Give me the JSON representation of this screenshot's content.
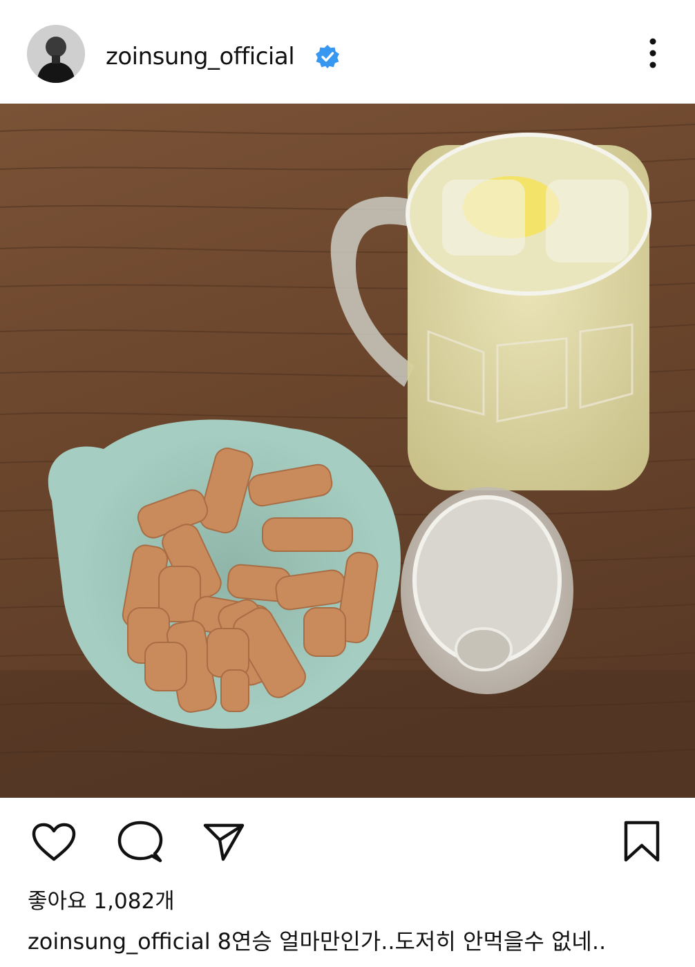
{
  "post": {
    "username": "zoinsung_official",
    "verified": true,
    "likes_label": "좋아요",
    "likes_count": "1,082개",
    "caption_username": "zoinsung_official",
    "caption_text": "8연승 얼마만인가..도저히 안먹을수 없네.."
  },
  "icons": {
    "verified": "verified-badge-icon",
    "more": "more-options-icon",
    "like": "heart-icon",
    "comment": "comment-icon",
    "share": "send-icon",
    "save": "bookmark-icon"
  },
  "colors": {
    "verified_badge": "#3897f0",
    "text": "#111111",
    "background": "#ffffff"
  }
}
